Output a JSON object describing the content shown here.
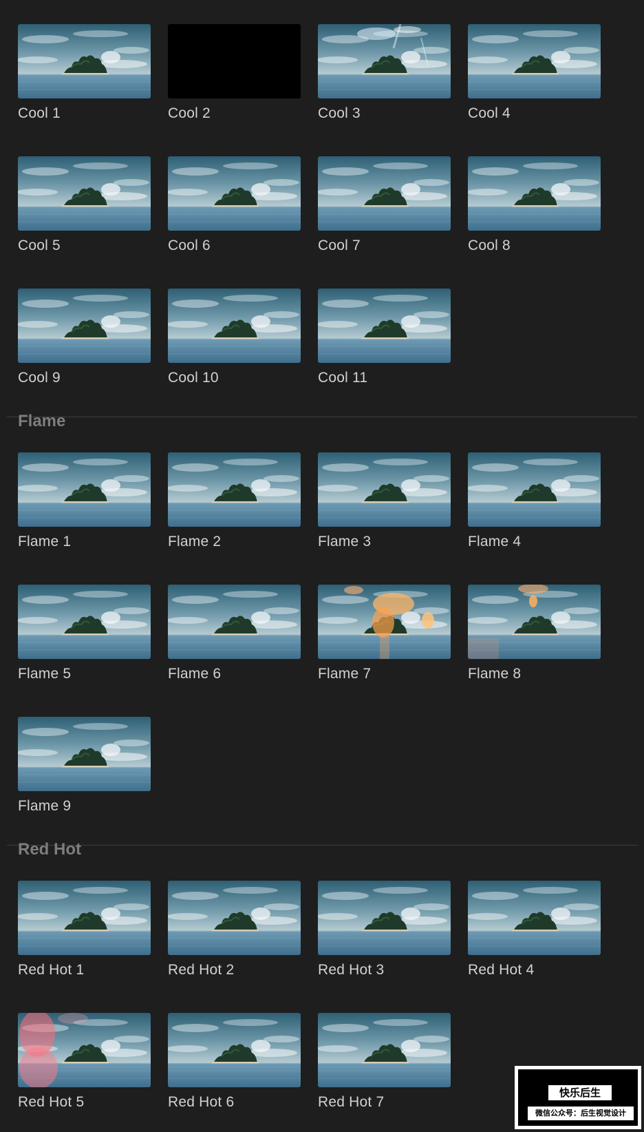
{
  "sections": [
    {
      "title": "",
      "items": [
        {
          "label": "Cool 1",
          "effect": "island"
        },
        {
          "label": "Cool 2",
          "effect": "black"
        },
        {
          "label": "Cool 3",
          "effect": "island-light-streaks"
        },
        {
          "label": "Cool 4",
          "effect": "island"
        },
        {
          "label": "Cool 5",
          "effect": "island"
        },
        {
          "label": "Cool 6",
          "effect": "island"
        },
        {
          "label": "Cool 7",
          "effect": "island"
        },
        {
          "label": "Cool 8",
          "effect": "island"
        },
        {
          "label": "Cool 9",
          "effect": "island"
        },
        {
          "label": "Cool 10",
          "effect": "island"
        },
        {
          "label": "Cool 11",
          "effect": "island"
        }
      ]
    },
    {
      "title": "Flame",
      "items": [
        {
          "label": "Flame 1",
          "effect": "island"
        },
        {
          "label": "Flame 2",
          "effect": "island"
        },
        {
          "label": "Flame 3",
          "effect": "island"
        },
        {
          "label": "Flame 4",
          "effect": "island"
        },
        {
          "label": "Flame 5",
          "effect": "island"
        },
        {
          "label": "Flame 6",
          "effect": "island"
        },
        {
          "label": "Flame 7",
          "effect": "island-flame-glow"
        },
        {
          "label": "Flame 8",
          "effect": "island-flame-light"
        },
        {
          "label": "Flame 9",
          "effect": "island"
        }
      ]
    },
    {
      "title": "Red Hot",
      "items": [
        {
          "label": "Red Hot 1",
          "effect": "island"
        },
        {
          "label": "Red Hot 2",
          "effect": "island"
        },
        {
          "label": "Red Hot 3",
          "effect": "island"
        },
        {
          "label": "Red Hot 4",
          "effect": "island"
        },
        {
          "label": "Red Hot 5",
          "effect": "island-red-glow"
        },
        {
          "label": "Red Hot 6",
          "effect": "island"
        },
        {
          "label": "Red Hot 7",
          "effect": "island"
        }
      ]
    }
  ],
  "watermark": {
    "logo_text": "快乐后生",
    "subtitle": "微信公众号：后生视觉设计"
  },
  "colors": {
    "background": "#1e1e1e",
    "label": "#d2d2d2",
    "section_title": "#7d7d7d",
    "divider": "#3f3f3f"
  }
}
